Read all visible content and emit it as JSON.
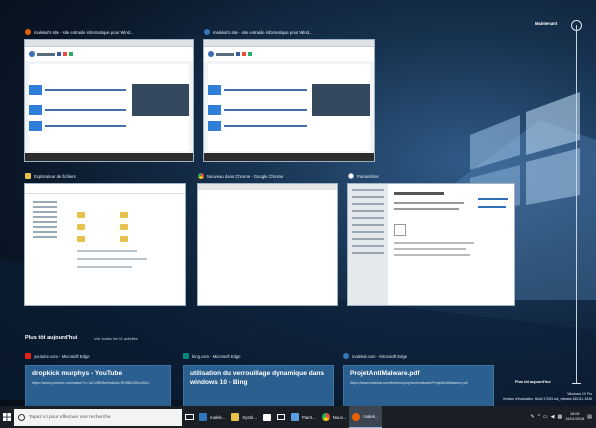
{
  "windows": [
    {
      "title": "malekal's site - site entraide informatique pour Wind...",
      "icon": "firefox-icon",
      "icon_color": "#e66000"
    },
    {
      "title": "malekal's site - site entraide informatique pour Wind...",
      "icon": "edge-icon",
      "icon_color": "#3277bc"
    },
    {
      "title": "Explorateur de fichiers",
      "icon": "folder-icon",
      "icon_color": "#e8c14a"
    },
    {
      "title": "Nouveau dans Chrome - Google Chrome",
      "icon": "chrome-icon",
      "icon_color": "#4caf50"
    },
    {
      "title": "Paramètres",
      "icon": "gear-icon",
      "icon_color": "#ffffff"
    }
  ],
  "timeline": {
    "now_label": "Maintenant",
    "earlier_label": "Plus tôt aujourd'hui"
  },
  "earlier": {
    "title": "Plus tôt aujourd'hui",
    "subtitle": "Voir toutes les 11 activités",
    "cards": [
      {
        "source": "youtube.com - Microsoft Edge",
        "icon": "youtube-icon",
        "icon_color": "#e62117",
        "title": "dropkick murphys - YouTube",
        "url": "https://www.youtube.com/watch?v=1dCxBE0ke9w&list=RD8BA35Ko4WLI"
      },
      {
        "source": "bing.com - Microsoft Edge",
        "icon": "bing-icon",
        "icon_color": "#00897b",
        "title": "utilisation du verrouillage dynamique dans windows 10 - Bing",
        "url": ""
      },
      {
        "source": "malekal.com - Microsoft Edge",
        "icon": "edge-icon",
        "icon_color": "#3277bc",
        "title": "ProjetAntiMalware.pdf",
        "url": "https://www.malekal.com/fichiers/projetantimalware/ProjetAntiMalware.pdf"
      }
    ]
  },
  "watermark": {
    "line1": "Windows 10 Pro",
    "line2": "Version d'évaluation. Build 17063.rs4_release.180111-1545"
  },
  "taskbar": {
    "search_placeholder": "Tapez ici pour effectuer une recherche",
    "items": [
      {
        "label": "malek...",
        "icon": "edge-icon",
        "color": "#3277bc",
        "active": false
      },
      {
        "label": "Systè...",
        "icon": "folder-icon",
        "color": "#e8c14a",
        "active": false
      },
      {
        "label": "Paint...",
        "icon": "paint-icon",
        "color": "#5aa0e0",
        "active": false
      },
      {
        "label": "Nouv...",
        "icon": "chrome-icon",
        "color": "#4caf50",
        "active": false
      },
      {
        "label": "malek...",
        "icon": "firefox-icon",
        "color": "#e66000",
        "active": true
      }
    ],
    "time": "18:08",
    "date": "15/01/2018"
  }
}
